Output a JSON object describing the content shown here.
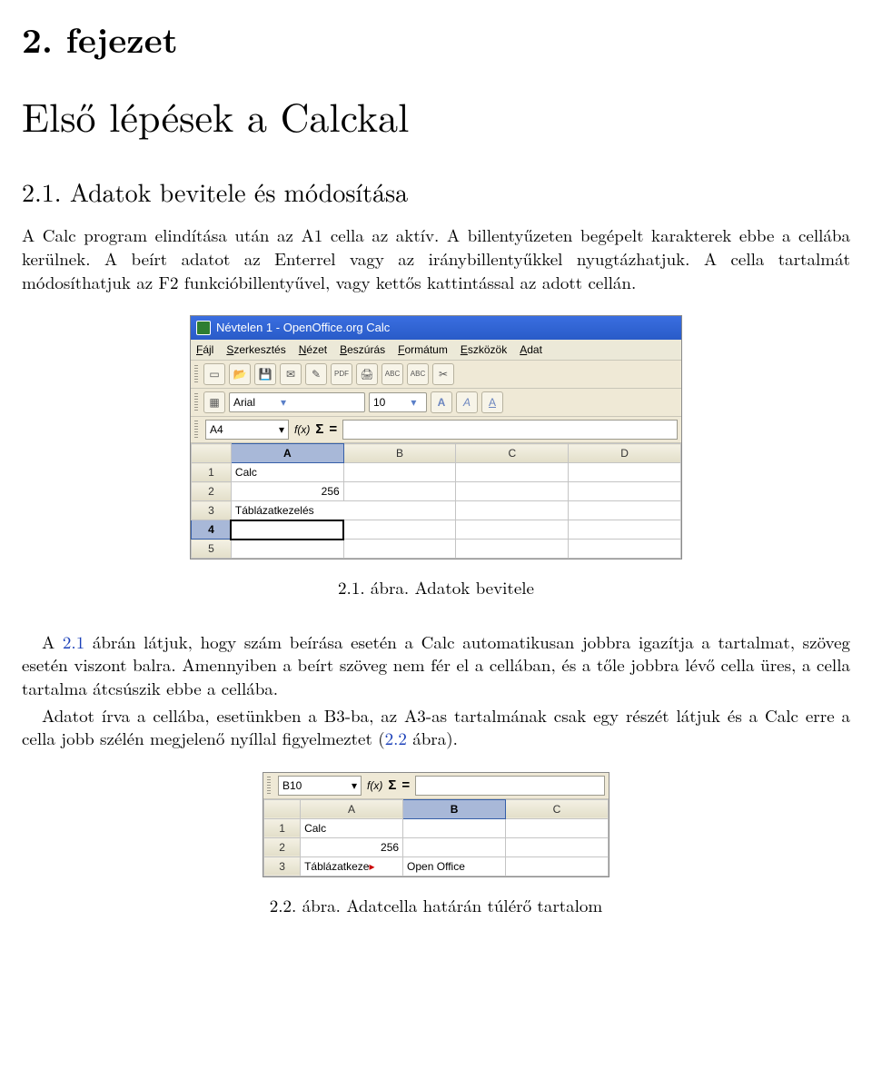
{
  "chapter_label": "2. fejezet",
  "chapter_title": "Első lépések a Calckal",
  "section_title": "2.1. Adatok bevitele és módosítása",
  "p1": "A Calc program elindítása után az A1 cella az aktív. A billentyűzeten begépelt karakterek ebbe a cellába kerülnek. A beírt adatot az Enterrel vagy az iránybillentyűkkel nyugtázhatjuk. A cella tartalmát módosíthatjuk az F2 funkcióbillentyűvel, vagy kettős kattintással az adott cellán.",
  "fig1_caption": "2.1. ábra. Adatok bevitele",
  "p2_a": "A ",
  "p2_link": "2.1",
  "p2_b": " ábrán látjuk, hogy szám beírása esetén a Calc automatikusan jobbra igazítja a tartalmat, szöveg esetén viszont balra. Amennyiben a beírt szöveg nem fér el a cellában, és a tőle jobbra lévő cella üres, a cella tartalma átcsúszik ebbe a cellába.",
  "p3_a": "Adatot írva a cellába, esetünkben a B3-ba, az A3-as tartalmának csak egy részét látjuk és a Calc erre a cella jobb szélén megjelenő nyíllal figyelmeztet (",
  "p3_link": "2.2",
  "p3_b": " ábra).",
  "fig2_caption": "2.2. ábra. Adatcella határán túlérő tartalom",
  "oo": {
    "title": "Névtelen 1 - OpenOffice.org Calc",
    "menu": [
      "Fájl",
      "Szerkesztés",
      "Nézet",
      "Beszúrás",
      "Formátum",
      "Eszközök",
      "Adat"
    ],
    "font_name": "Arial",
    "font_size": "10",
    "cell_ref_1": "A4",
    "cell_ref_2": "B10",
    "cols": [
      "A",
      "B",
      "C",
      "D"
    ],
    "cols2": [
      "A",
      "B",
      "C"
    ],
    "rows1": [
      {
        "n": "1",
        "a": "Calc",
        "b": "",
        "c": "",
        "d": ""
      },
      {
        "n": "2",
        "a": "256",
        "b": "",
        "c": "",
        "d": "",
        "anum": true
      },
      {
        "n": "3",
        "a": "Táblázatkezelés",
        "b": "",
        "c": "",
        "d": ""
      },
      {
        "n": "4",
        "a": "",
        "b": "",
        "c": "",
        "d": ""
      },
      {
        "n": "5",
        "a": "",
        "b": "",
        "c": "",
        "d": ""
      }
    ],
    "rows2": [
      {
        "n": "1",
        "a": "Calc",
        "b": "",
        "c": ""
      },
      {
        "n": "2",
        "a": "256",
        "b": "",
        "c": "",
        "anum": true
      },
      {
        "n": "3",
        "a": "Táblázatkeze",
        "b": "Open Office",
        "c": ""
      }
    ],
    "icons": {
      "new": "▭",
      "open": "📂",
      "save": "💾",
      "mail": "✉",
      "edit": "✎",
      "pdf": "PDF",
      "print": "🖨",
      "abc": "ABC",
      "abc2": "ABC",
      "cut": "✂",
      "grid": "▦",
      "A_bold": "A",
      "A_italic": "A",
      "A_under": "A"
    }
  }
}
